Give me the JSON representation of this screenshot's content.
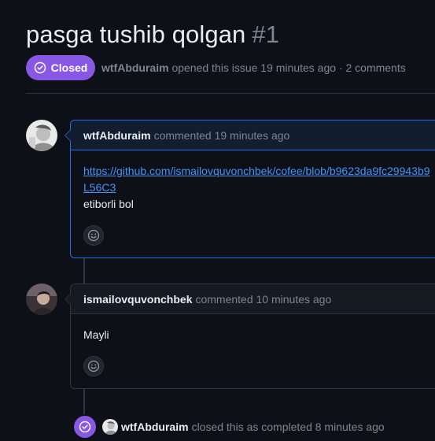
{
  "issue": {
    "title": "pasga tushib qolgan",
    "number": "#1",
    "state": "Closed",
    "author": "wtfAbduraim",
    "meta_text": "opened this issue 19 minutes ago · 2 comments"
  },
  "comments": [
    {
      "author": "wtfAbduraim",
      "header_text": "commented 19 minutes ago",
      "link": "https://github.com/ismailovquvonchbek/cofee/blob/b9623da9fc29943b9",
      "link_wrap": "L56C3",
      "text": "etiborli bol",
      "avatar_icon": "avatar-photo",
      "reaction_icon": "smiley-icon"
    },
    {
      "author": "ismailovquvonchbek",
      "header_text": "commented 10 minutes ago",
      "text": "Mayli",
      "avatar_icon": "avatar-photo",
      "reaction_icon": "smiley-icon"
    }
  ],
  "event": {
    "author": "wtfAbduraim",
    "text": "closed this as completed 8 minutes ago",
    "icon": "check-circle-icon"
  },
  "colors": {
    "background": "#0d1117",
    "closed_purple": "#8957e5",
    "link_blue": "#4493f8",
    "border": "#30363d",
    "highlight_border": "#1f6feb",
    "muted_text": "#7d8590"
  }
}
